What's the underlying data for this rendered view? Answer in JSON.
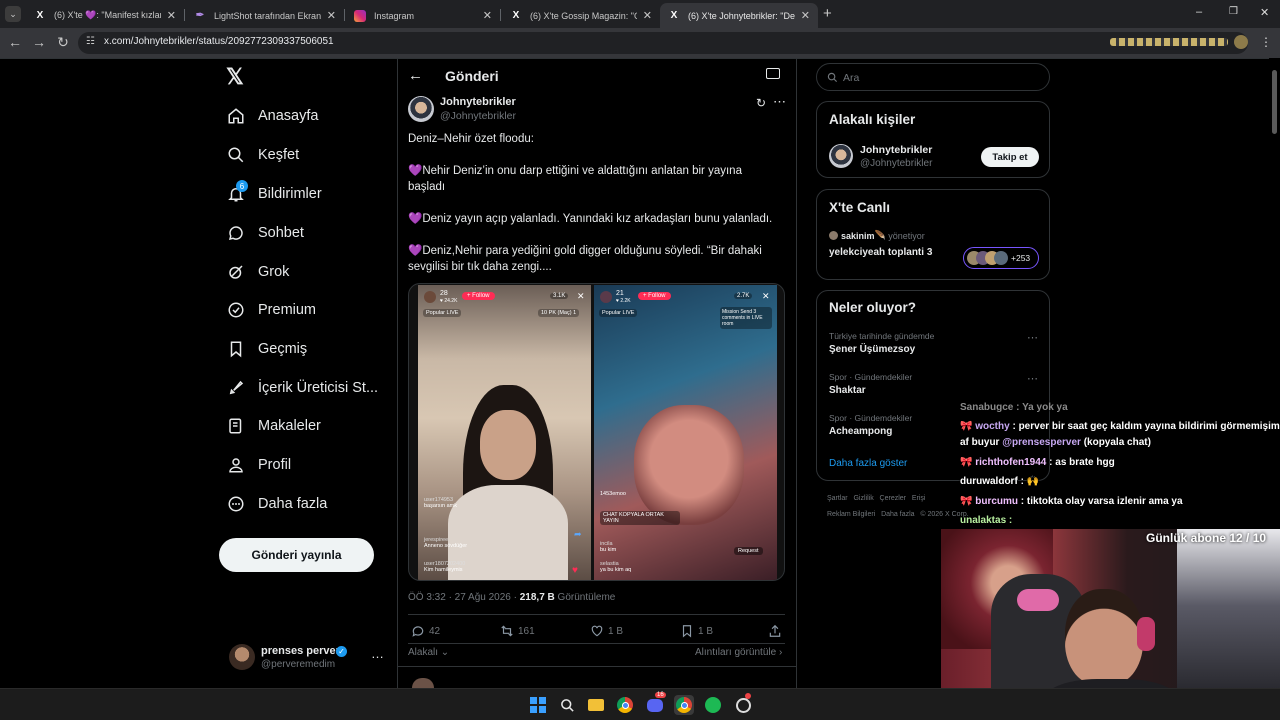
{
  "browser": {
    "tabs": [
      {
        "title": "(6) X'te 💜: \"Manifest kızlar, fan",
        "active": false
      },
      {
        "title": "LightShot tarafından Ekran Gör",
        "active": false
      },
      {
        "title": "Instagram",
        "active": false
      },
      {
        "title": "(6) X'te Gossip Magazin: \"Gizem",
        "active": false
      },
      {
        "title": "(6) X'te Johnytebrikler: \"Deniz-N",
        "active": true
      }
    ],
    "new_tab": "+",
    "url": "x.com/Johnytebrikler/status/2092772309337506051",
    "window_controls": [
      "–",
      "❒",
      "✕"
    ]
  },
  "sidebar": {
    "logo": "𝕏",
    "items": [
      {
        "label": "Anasayfa",
        "icon": "home-icon"
      },
      {
        "label": "Keşfet",
        "icon": "search-icon"
      },
      {
        "label": "Bildirimler",
        "icon": "bell-icon",
        "badge": "6"
      },
      {
        "label": "Sohbet",
        "icon": "chat-icon"
      },
      {
        "label": "Grok",
        "icon": "grok-icon"
      },
      {
        "label": "Premium",
        "icon": "premium-icon"
      },
      {
        "label": "Geçmiş",
        "icon": "bookmark-icon"
      },
      {
        "label": "İçerik Üreticisi St...",
        "icon": "rocket-icon"
      },
      {
        "label": "Makaleler",
        "icon": "article-icon"
      },
      {
        "label": "Profil",
        "icon": "user-icon"
      },
      {
        "label": "Daha fazla",
        "icon": "more-circle-icon"
      }
    ],
    "post_button": "Gönderi yayınla",
    "account": {
      "name": "prenses perver",
      "handle": "@perveremedim",
      "more": "…"
    }
  },
  "tweet": {
    "header_title": "Gönderi",
    "author_name": "Johnytebrikler",
    "author_handle": "@Johnytebrikler",
    "paragraphs": [
      {
        "heart": "",
        "text": "Deniz–Nehir özet floodu:"
      },
      {
        "heart": "💜",
        "text": "Nehir Deniz’in onu darp ettiğini ve aldattığını anlatan bir yayına başladı"
      },
      {
        "heart": "💜",
        "text": "Deniz yayın açıp yalanladı. Yanındaki kız arkadaşları bunu yalanladı."
      },
      {
        "heart": "💜",
        "text": "Deniz,Nehir para yediğini gold digger olduğunu söyledi. “Bir dahaki sevgilisi bir tık daha zengi...."
      }
    ],
    "media": {
      "left": {
        "likes": "28",
        "sub": "♥ 24.2K",
        "follow": "+ Follow",
        "viewers": "3.1K",
        "popular": "Popular LIVE",
        "pk": "10 PK (Maç) 1",
        "comments": [
          {
            "user": "user174953",
            "text": "başarsın amk"
          },
          {
            "user": "jerespiree",
            "text": "Anneno sövdüğer"
          },
          {
            "user": "user1807202400",
            "text": "Kim hamileymis"
          }
        ]
      },
      "right": {
        "likes": "21",
        "sub": "♥ 2.2K",
        "follow": "+ Follow",
        "viewers": "2.7K",
        "popular": "Popular LIVE",
        "mission": "Mission Send 3 comments in LIVE room",
        "chat_banner": "CHAT KOPYALA ORTAK YAYIN",
        "comments": [
          {
            "user": "1453emoo",
            "text": ""
          },
          {
            "user": "incila",
            "text": "bu kim"
          },
          {
            "user": "selastia",
            "text": "ya bu kim aq"
          }
        ],
        "request": "Request"
      }
    },
    "time": "ÖÖ 3:32 · 27 Ağu 2026 · ",
    "views_count": "218,7 B",
    "views_label": " Görüntüleme",
    "actions": {
      "replies": "42",
      "reposts": "161",
      "likes": "1 B",
      "bookmarks": "1 B"
    },
    "relevant": "Alakalı",
    "quotes": "Alıntıları görüntüle"
  },
  "right": {
    "search_placeholder": "Ara",
    "people": {
      "title": "Alakalı kişiler",
      "name": "Johnytebrikler",
      "handle": "@Johnytebrikler",
      "follow": "Takip et"
    },
    "live": {
      "title": "X'te Canlı",
      "host": "sakinim",
      "host_emoji": "🪶",
      "role": "yönetiyor",
      "space": "yelekciyeah toplanti 3",
      "count": "+253"
    },
    "trends": {
      "title": "Neler oluyor?",
      "items": [
        {
          "context": "Türkiye tarihinde gündemde",
          "name": "Şener Üşümezsoy"
        },
        {
          "context": "Spor · Gündemdekiler",
          "name": "Shaktar"
        },
        {
          "context": "Spor · Gündemdekiler",
          "name": "Acheampong"
        }
      ],
      "more": "Daha fazla göster"
    },
    "footer": {
      "line1": [
        "Şartlar",
        "Gizlilik",
        "Çerezler",
        "Erişi"
      ],
      "line2": [
        "Reklam Bilgileri",
        "Daha fazla",
        "© 2026 X Corp."
      ]
    }
  },
  "overlay": {
    "chat": [
      {
        "user": "Sanabugce",
        "text": ": Ya yok ya",
        "badge": ""
      },
      {
        "user": "wocthy",
        "text": ": perver bir saat geç kaldım yayına bildirimi görmemişim",
        "badge": "🎀"
      },
      {
        "user": "",
        "text": "af buyur ",
        "mention": "@prensesperver",
        "tail": " (kopyala chat)",
        "badge": ""
      },
      {
        "user": "richthofen1944",
        "text": ": as brate hgg",
        "badge": "🎀"
      },
      {
        "user": "duruwaldorf",
        "text": ": ",
        "emote": "🙌",
        "badge": ""
      },
      {
        "user": "burcumu",
        "text": ": tiktokta olay varsa izlenir ama ya",
        "badge": "🎀"
      },
      {
        "user": "unalaktas",
        "text": ":",
        "badge": ""
      }
    ],
    "sub_goal": "Günlük abone 12 / 10"
  },
  "taskbar": {
    "icons": [
      "windows-start-icon",
      "search-icon",
      "file-explorer-icon",
      "chrome-icon",
      "discord-icon",
      "chrome-icon",
      "spotify-icon",
      "app-icon"
    ],
    "badges": {
      "discord": "16"
    }
  },
  "colors": {
    "bg": "#000000",
    "text": "#e7e9ea",
    "muted": "#71767b",
    "border": "#2f3336",
    "accent": "#1d9bf0",
    "heart": "#a26bd8"
  }
}
